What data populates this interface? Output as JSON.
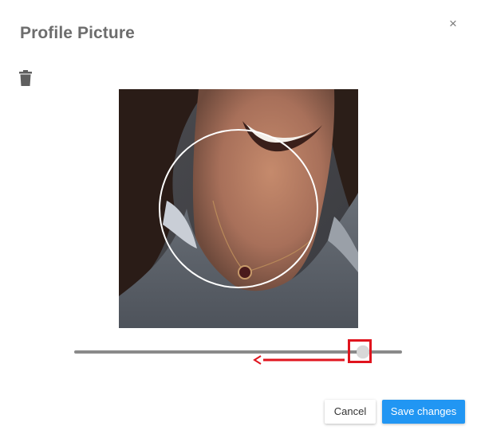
{
  "dialog": {
    "title": "Profile Picture",
    "close_label": "×"
  },
  "toolbar": {
    "delete_icon": "trash-icon"
  },
  "photo": {
    "crop_shape": "circle"
  },
  "zoom_slider": {
    "value_fraction": 0.88
  },
  "annotation": {
    "arrow_glyph": "<",
    "highlight_color": "#e0141e"
  },
  "actions": {
    "cancel_label": "Cancel",
    "save_label": "Save changes"
  },
  "colors": {
    "primary": "#2196f3",
    "title": "#6d6d6d"
  }
}
